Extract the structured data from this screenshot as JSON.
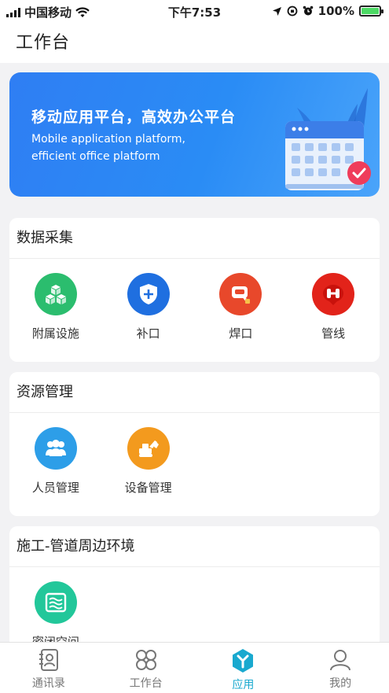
{
  "status_bar": {
    "carrier": "中国移动",
    "time": "下午7:53",
    "battery": "100%",
    "battery_level": 1.0
  },
  "header": {
    "title": "工作台"
  },
  "banner": {
    "headline": "移动应用平台，高效办公平台",
    "subtitle_line1": "Mobile application platform,",
    "subtitle_line2": "efficient office platform"
  },
  "sections": [
    {
      "title": "数据采集",
      "items": [
        {
          "label": "附属设施",
          "icon": "cubes-icon",
          "color": "#2bbd6e"
        },
        {
          "label": "补口",
          "icon": "shield-plus-icon",
          "color": "#1f6fe0"
        },
        {
          "label": "焊口",
          "icon": "weld-icon",
          "color": "#e8482b"
        },
        {
          "label": "管线",
          "icon": "pipeline-icon",
          "color": "#e2231a"
        }
      ]
    },
    {
      "title": "资源管理",
      "items": [
        {
          "label": "人员管理",
          "icon": "people-icon",
          "color": "#2d9ee8"
        },
        {
          "label": "设备管理",
          "icon": "excavator-icon",
          "color": "#f39a1e"
        }
      ]
    },
    {
      "title": "施工-管道周边环境",
      "items": [
        {
          "label": "密闭空间",
          "icon": "enclosed-space-icon",
          "color": "#22c79a"
        }
      ]
    }
  ],
  "tabbar": {
    "tabs": [
      {
        "label": "通讯录",
        "icon": "contacts-icon"
      },
      {
        "label": "工作台",
        "icon": "workbench-icon"
      },
      {
        "label": "应用",
        "icon": "apps-icon",
        "active": true
      },
      {
        "label": "我的",
        "icon": "profile-icon"
      }
    ],
    "active_color": "#19a9cf"
  }
}
